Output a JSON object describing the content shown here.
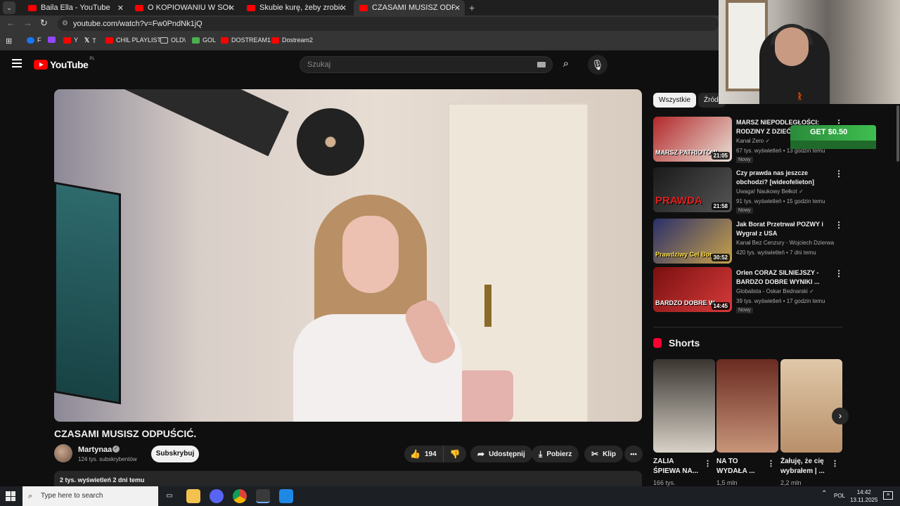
{
  "browser": {
    "tabs": [
      {
        "title": "Baila Ella - YouTube"
      },
      {
        "title": "O KOPIOWANIU W SOCIAL ME..."
      },
      {
        "title": "Skubie kurę, żeby zrobić z niej..."
      },
      {
        "title": "CZASAMI MUSISZ ODPUŚCIĆ..."
      }
    ],
    "new_tab": "+",
    "url": "youtube.com/watch?v=Fw0PndNk1jQ",
    "bookmarks": [
      {
        "label": "F",
        "color": "#1877f2"
      },
      {
        "label": "",
        "color": "#9146ff"
      },
      {
        "label": "Y",
        "color": "#ff0000"
      },
      {
        "label": "T",
        "color": "#ffffff"
      },
      {
        "label": "CHIL PLAYLIST",
        "color": "#ff0000"
      },
      {
        "label": "OLD\\",
        "color": "#cccccc"
      },
      {
        "label": "GOL",
        "color": "#4caf50"
      },
      {
        "label": "DOSTREAM1",
        "color": "#ff0000"
      },
      {
        "label": "Dostream2",
        "color": "#ff0000"
      }
    ]
  },
  "yt": {
    "logo_text": "YouTube",
    "logo_region": "PL",
    "search_placeholder": "Szukaj"
  },
  "video": {
    "title": "CZASAMI MUSISZ ODPUŚCIĆ.",
    "channel": "Martynaa",
    "subscribers": "124 tys. subskrybentów",
    "subscribe_label": "Subskrybuj",
    "likes": "194",
    "share_label": "Udostępnij",
    "download_label": "Pobierz",
    "clip_label": "Klip",
    "more_label": "•••",
    "desc_meta": "2 tys. wyświetleń  2 dni temu"
  },
  "sidebar": {
    "chips": [
      "Wszystkie",
      "Źródł"
    ],
    "recommended": [
      {
        "title": "MARSZ NIEPODLEGŁOŚCI: RODZINY Z DZIEĆMI",
        "channel": "Kanał Zero",
        "verified": true,
        "meta": "67 tys. wyświetleń • 13 godzin temu",
        "badge": "Nowy",
        "duration": "21:05",
        "overlay": "MARSZ PATRIOTÓW",
        "thumb_colors": [
          "#b3272a",
          "#e8e0d5"
        ]
      },
      {
        "title": "Czy prawda nas jeszcze obchodzi? [wideofelieton]",
        "channel": "Uwaga! Naukowy Bełkot",
        "verified": true,
        "meta": "91 tys. wyświetleń • 15 godzin temu",
        "badge": "Nowy",
        "duration": "21:58",
        "overlay": "PRAWDA",
        "thumb_colors": [
          "#1a1a1a",
          "#555"
        ]
      },
      {
        "title": "Jak Borat Przetrwał POZWY i Wygrał z USA",
        "channel": "Kanał Bez Cenzury - Wojciech Dzierwa",
        "verified": false,
        "meta": "420 tys. wyświetleń • 7 dni temu",
        "badge": "",
        "duration": "30:52",
        "overlay": "Prawdziwy Cel Bor",
        "thumb_colors": [
          "#2a2f6a",
          "#c9a24a"
        ]
      },
      {
        "title": "Orlen CORAZ SILNIEJSZY - BARDZO DOBRE WYNIKI ...",
        "channel": "Globalista - Oskar Bednarski",
        "verified": true,
        "meta": "39 tys. wyświetleń • 17 godzin temu",
        "badge": "Nowy",
        "duration": "14:45",
        "overlay": "BARDZO DOBRE W",
        "thumb_colors": [
          "#7a1010",
          "#d63a3a"
        ]
      }
    ],
    "shorts_label": "Shorts",
    "shorts": [
      {
        "title": "ZALIA ŚPIEWA NA...",
        "views": "166 tys.",
        "colors": [
          "#3a3530",
          "#d8d2c8"
        ]
      },
      {
        "title": "NA TO WYDAŁA ...",
        "views": "1,5 mln",
        "colors": [
          "#6a2a20",
          "#c8957a"
        ]
      },
      {
        "title": "Żałuję, że cię wybrałem | ...",
        "views": "2,2 mln",
        "colors": [
          "#e0c8a8",
          "#b8906a"
        ]
      }
    ]
  },
  "overlay": {
    "get_badge": "GET $0.50"
  },
  "taskbar": {
    "search_placeholder": "Type here to search",
    "lang": "POL",
    "time": "14:42",
    "date": "13.11.2025"
  }
}
